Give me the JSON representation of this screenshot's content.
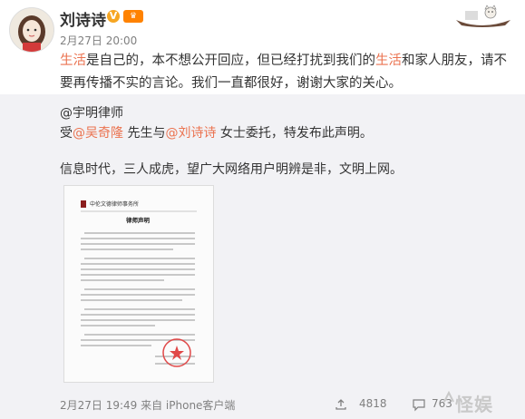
{
  "post": {
    "username": "刘诗诗",
    "verified_icon": "verified-badge-icon",
    "vip_icon": "vip-badge-icon",
    "time": "2月27日 20:00",
    "text_parts": [
      {
        "text": "生活",
        "highlight": true
      },
      {
        "text": "是自己的，本不想公开回应，但已经打扰到我们的",
        "highlight": false
      },
      {
        "text": "生活",
        "highlight": true
      },
      {
        "text": "和家人朋友，请不要再传播不实的言论。我们一直都很好，谢谢大家的关心。",
        "highlight": false
      }
    ]
  },
  "repost": {
    "author": "@宇明律师",
    "line1_prefix": "受",
    "mention1": "@吴奇隆",
    "line1_mid": " 先生与",
    "mention2": "@刘诗诗",
    "line1_suffix": " 女士委托，特发布此声明。",
    "line2": "信息时代，三人成虎，望广大网络用户明辨是非，文明上网。",
    "doc_title": "律师声明",
    "doc_firm": "中伦文德律师事务所"
  },
  "footer": {
    "time_source": "2月27日 19:49 来自 iPhone客户端",
    "share_icon": "share-icon",
    "share_count": "4818",
    "comment_icon": "comment-icon",
    "comment_count": "763"
  },
  "watermark": {
    "text": "怪娱"
  },
  "colors": {
    "highlight": "#eb7350",
    "repost_bg": "#f2f2f5",
    "text": "#333333",
    "meta": "#808080"
  }
}
